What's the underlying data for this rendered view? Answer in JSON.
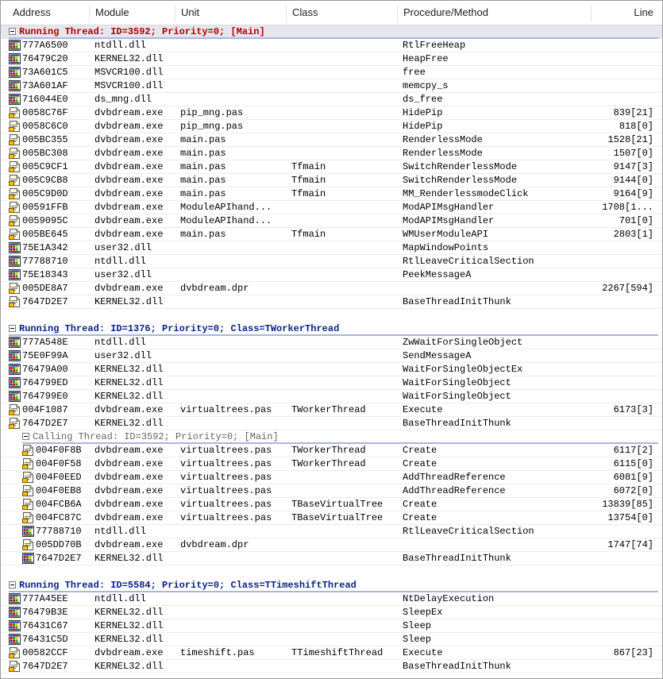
{
  "columns": [
    "Address",
    "Module",
    "Unit",
    "Class",
    "Procedure/Method",
    "Line"
  ],
  "icon_names": {
    "mod": "module-icon",
    "src": "source-icon"
  },
  "colors": {
    "main_thread_text": "#b00000",
    "thread_text": "#0b1f8a",
    "calling_thread_text": "#666666",
    "separator": "#a7b7d9"
  },
  "rows": [
    {
      "t": "thread",
      "v": "main",
      "text": "Running Thread: ID=3592; Priority=0; [Main]"
    },
    {
      "t": "row",
      "icon": "mod",
      "c": [
        "777A6500",
        "ntdll.dll",
        "",
        "",
        "RtlFreeHeap",
        ""
      ]
    },
    {
      "t": "row",
      "icon": "mod",
      "c": [
        "76479C20",
        "KERNEL32.dll",
        "",
        "",
        "HeapFree",
        ""
      ]
    },
    {
      "t": "row",
      "icon": "mod",
      "c": [
        "73A601C5",
        "MSVCR100.dll",
        "",
        "",
        "free",
        ""
      ]
    },
    {
      "t": "row",
      "icon": "mod",
      "c": [
        "73A601AF",
        "MSVCR100.dll",
        "",
        "",
        "memcpy_s",
        ""
      ]
    },
    {
      "t": "row",
      "icon": "mod",
      "c": [
        "716044E0",
        "ds_mng.dll",
        "",
        "",
        "ds_free",
        ""
      ]
    },
    {
      "t": "row",
      "icon": "src",
      "c": [
        "0058C76F",
        "dvbdream.exe",
        "pip_mng.pas",
        "",
        "HidePip",
        "839[21]"
      ]
    },
    {
      "t": "row",
      "icon": "src",
      "c": [
        "0058C6C0",
        "dvbdream.exe",
        "pip_mng.pas",
        "",
        "HidePip",
        "818[0]"
      ]
    },
    {
      "t": "row",
      "icon": "src",
      "c": [
        "005BC355",
        "dvbdream.exe",
        "main.pas",
        "",
        "RenderlessMode",
        "1528[21]"
      ]
    },
    {
      "t": "row",
      "icon": "src",
      "c": [
        "005BC308",
        "dvbdream.exe",
        "main.pas",
        "",
        "RenderlessMode",
        "1507[0]"
      ]
    },
    {
      "t": "row",
      "icon": "src",
      "c": [
        "005C9CF1",
        "dvbdream.exe",
        "main.pas",
        "Tfmain",
        "SwitchRenderlessMode",
        "9147[3]"
      ]
    },
    {
      "t": "row",
      "icon": "src",
      "c": [
        "005C9CB8",
        "dvbdream.exe",
        "main.pas",
        "Tfmain",
        "SwitchRenderlessMode",
        "9144[0]"
      ]
    },
    {
      "t": "row",
      "icon": "src",
      "c": [
        "005C9D0D",
        "dvbdream.exe",
        "main.pas",
        "Tfmain",
        "MM_RenderlessmodeClick",
        "9164[9]"
      ]
    },
    {
      "t": "row",
      "icon": "src",
      "c": [
        "00591FFB",
        "dvbdream.exe",
        "ModuleAPIhand...",
        "",
        "ModAPIMsgHandler",
        "1708[1..."
      ]
    },
    {
      "t": "row",
      "icon": "src",
      "c": [
        "0059095C",
        "dvbdream.exe",
        "ModuleAPIhand...",
        "",
        "ModAPIMsgHandler",
        "701[0]"
      ]
    },
    {
      "t": "row",
      "icon": "src",
      "c": [
        "005BE645",
        "dvbdream.exe",
        "main.pas",
        "Tfmain",
        "WMUserModuleAPI",
        "2803[1]"
      ]
    },
    {
      "t": "row",
      "icon": "mod",
      "c": [
        "75E1A342",
        "user32.dll",
        "",
        "",
        "MapWindowPoints",
        ""
      ]
    },
    {
      "t": "row",
      "icon": "mod",
      "c": [
        "77788710",
        "ntdll.dll",
        "",
        "",
        "RtlLeaveCriticalSection",
        ""
      ]
    },
    {
      "t": "row",
      "icon": "mod",
      "c": [
        "75E18343",
        "user32.dll",
        "",
        "",
        "PeekMessageA",
        ""
      ]
    },
    {
      "t": "row",
      "icon": "src",
      "c": [
        "005DE8A7",
        "dvbdream.exe",
        "dvbdream.dpr",
        "",
        "",
        "2267[594]"
      ]
    },
    {
      "t": "row",
      "icon": "src",
      "c": [
        "7647D2E7",
        "KERNEL32.dll",
        "",
        "",
        "BaseThreadInitThunk",
        ""
      ]
    },
    {
      "t": "blank"
    },
    {
      "t": "thread",
      "v": "normal",
      "text": "Running Thread: ID=1376; Priority=0; Class=TWorkerThread"
    },
    {
      "t": "row",
      "icon": "mod",
      "c": [
        "777A548E",
        "ntdll.dll",
        "",
        "",
        "ZwWaitForSingleObject",
        ""
      ]
    },
    {
      "t": "row",
      "icon": "mod",
      "c": [
        "75E0F99A",
        "user32.dll",
        "",
        "",
        "SendMessageA",
        ""
      ]
    },
    {
      "t": "row",
      "icon": "mod",
      "c": [
        "76479A00",
        "KERNEL32.dll",
        "",
        "",
        "WaitForSingleObjectEx",
        ""
      ]
    },
    {
      "t": "row",
      "icon": "mod",
      "c": [
        "764799ED",
        "KERNEL32.dll",
        "",
        "",
        "WaitForSingleObject",
        ""
      ]
    },
    {
      "t": "row",
      "icon": "mod",
      "c": [
        "764799E0",
        "KERNEL32.dll",
        "",
        "",
        "WaitForSingleObject",
        ""
      ]
    },
    {
      "t": "row",
      "icon": "src",
      "c": [
        "004F1087",
        "dvbdream.exe",
        "virtualtrees.pas",
        "TWorkerThread",
        "Execute",
        "6173[3]"
      ]
    },
    {
      "t": "row",
      "icon": "src",
      "c": [
        "7647D2E7",
        "KERNEL32.dll",
        "",
        "",
        "BaseThreadInitThunk",
        ""
      ]
    },
    {
      "t": "thread",
      "v": "calling",
      "text": "Calling Thread: ID=3592; Priority=0; [Main]"
    },
    {
      "t": "row",
      "n": true,
      "icon": "src",
      "c": [
        "004F0F8B",
        "dvbdream.exe",
        "virtualtrees.pas",
        "TWorkerThread",
        "Create",
        "6117[2]"
      ]
    },
    {
      "t": "row",
      "n": true,
      "icon": "src",
      "c": [
        "004F0F58",
        "dvbdream.exe",
        "virtualtrees.pas",
        "TWorkerThread",
        "Create",
        "6115[0]"
      ]
    },
    {
      "t": "row",
      "n": true,
      "icon": "src",
      "c": [
        "004F0EED",
        "dvbdream.exe",
        "virtualtrees.pas",
        "",
        "AddThreadReference",
        "6081[9]"
      ]
    },
    {
      "t": "row",
      "n": true,
      "icon": "src",
      "c": [
        "004F0EB8",
        "dvbdream.exe",
        "virtualtrees.pas",
        "",
        "AddThreadReference",
        "6072[0]"
      ]
    },
    {
      "t": "row",
      "n": true,
      "icon": "src",
      "c": [
        "004FCB6A",
        "dvbdream.exe",
        "virtualtrees.pas",
        "TBaseVirtualTree",
        "Create",
        "13839[85]"
      ]
    },
    {
      "t": "row",
      "n": true,
      "icon": "src",
      "c": [
        "004FC87C",
        "dvbdream.exe",
        "virtualtrees.pas",
        "TBaseVirtualTree",
        "Create",
        "13754[0]"
      ]
    },
    {
      "t": "row",
      "n": true,
      "icon": "mod",
      "c": [
        "77788710",
        "ntdll.dll",
        "",
        "",
        "RtlLeaveCriticalSection",
        ""
      ]
    },
    {
      "t": "row",
      "n": true,
      "icon": "src",
      "c": [
        "005DD70B",
        "dvbdream.exe",
        "dvbdream.dpr",
        "",
        "",
        "1747[74]"
      ]
    },
    {
      "t": "row",
      "n": true,
      "icon": "mod",
      "c": [
        "7647D2E7",
        "KERNEL32.dll",
        "",
        "",
        "BaseThreadInitThunk",
        ""
      ]
    },
    {
      "t": "blank"
    },
    {
      "t": "thread",
      "v": "normal",
      "text": "Running Thread: ID=5584; Priority=0; Class=TTimeshiftThread"
    },
    {
      "t": "row",
      "icon": "mod",
      "c": [
        "777A45EE",
        "ntdll.dll",
        "",
        "",
        "NtDelayExecution",
        ""
      ]
    },
    {
      "t": "row",
      "icon": "mod",
      "c": [
        "76479B3E",
        "KERNEL32.dll",
        "",
        "",
        "SleepEx",
        ""
      ]
    },
    {
      "t": "row",
      "icon": "mod",
      "c": [
        "76431C67",
        "KERNEL32.dll",
        "",
        "",
        "Sleep",
        ""
      ]
    },
    {
      "t": "row",
      "icon": "mod",
      "c": [
        "76431C5D",
        "KERNEL32.dll",
        "",
        "",
        "Sleep",
        ""
      ]
    },
    {
      "t": "row",
      "icon": "src",
      "c": [
        "00582CCF",
        "dvbdream.exe",
        "timeshift.pas",
        "TTimeshiftThread",
        "Execute",
        "867[23]"
      ]
    },
    {
      "t": "row",
      "icon": "src",
      "c": [
        "7647D2E7",
        "KERNEL32.dll",
        "",
        "",
        "BaseThreadInitThunk",
        ""
      ]
    }
  ]
}
